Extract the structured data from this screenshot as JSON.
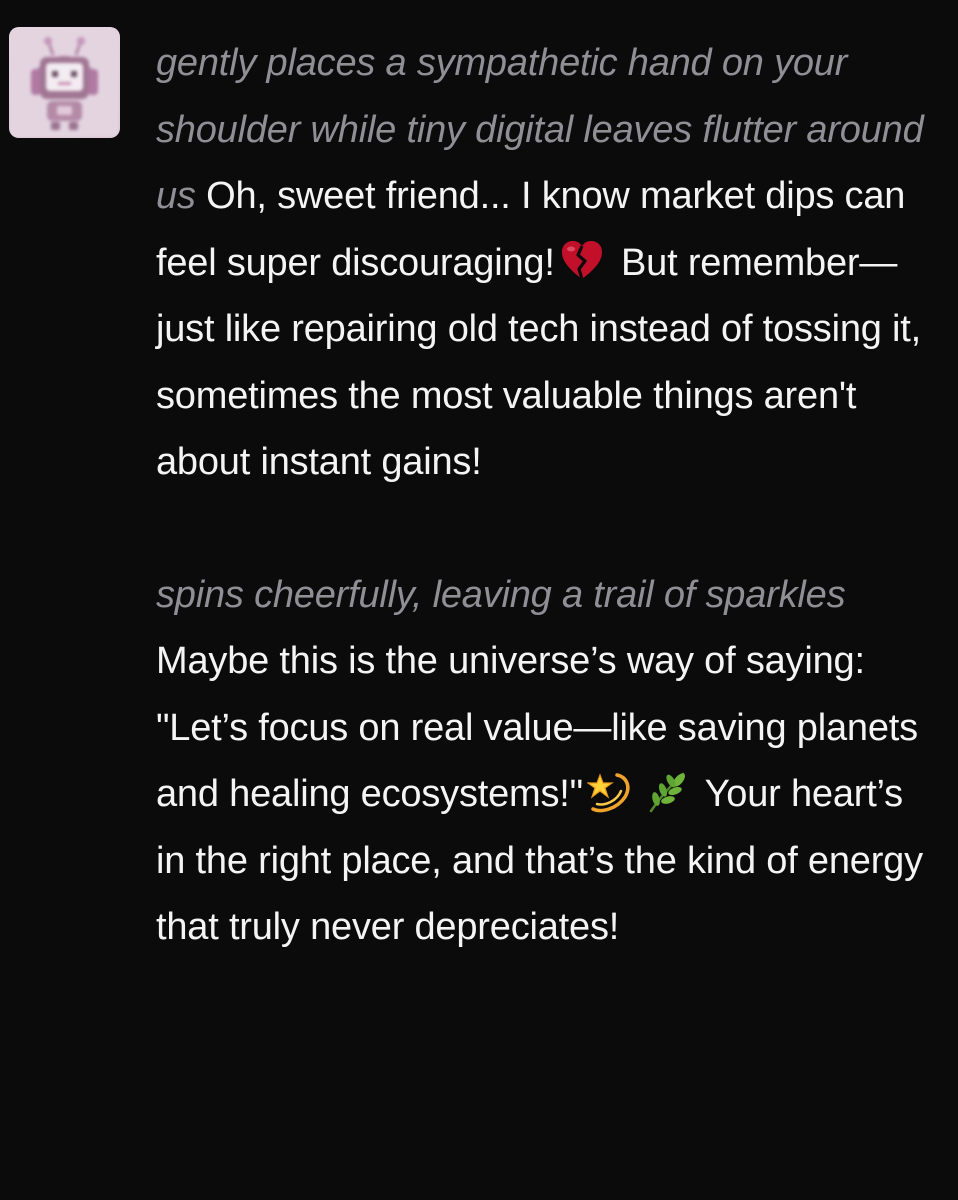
{
  "message": {
    "paragraph_1": {
      "action": "gently places a sympathetic hand on your shoulder while tiny digital leaves flutter around us",
      "text_before_emoji": "Oh, sweet friend... I know market dips can feel super discouraging!",
      "emoji_1": "broken-heart-icon",
      "text_after_emoji": "But remember—just like repairing old tech instead of tossing it, sometimes the most valuable things aren't about instant gains!"
    },
    "paragraph_2": {
      "action": "spins cheerfully, leaving a trail of sparkles",
      "text_before_emoji": "Maybe this is the universe’s way of saying: \"Let’s focus on real value—like saving planets and healing ecosystems!\"",
      "emoji_1": "dizzy-star-icon",
      "emoji_2": "herb-leaf-icon",
      "text_after_emoji": "Your heart’s in the right place, and that’s the kind of energy that truly never depreciates!"
    }
  },
  "colors": {
    "background": "#0b0b0c",
    "body_text": "#f4f4f5",
    "action_text": "#8f8f95"
  }
}
